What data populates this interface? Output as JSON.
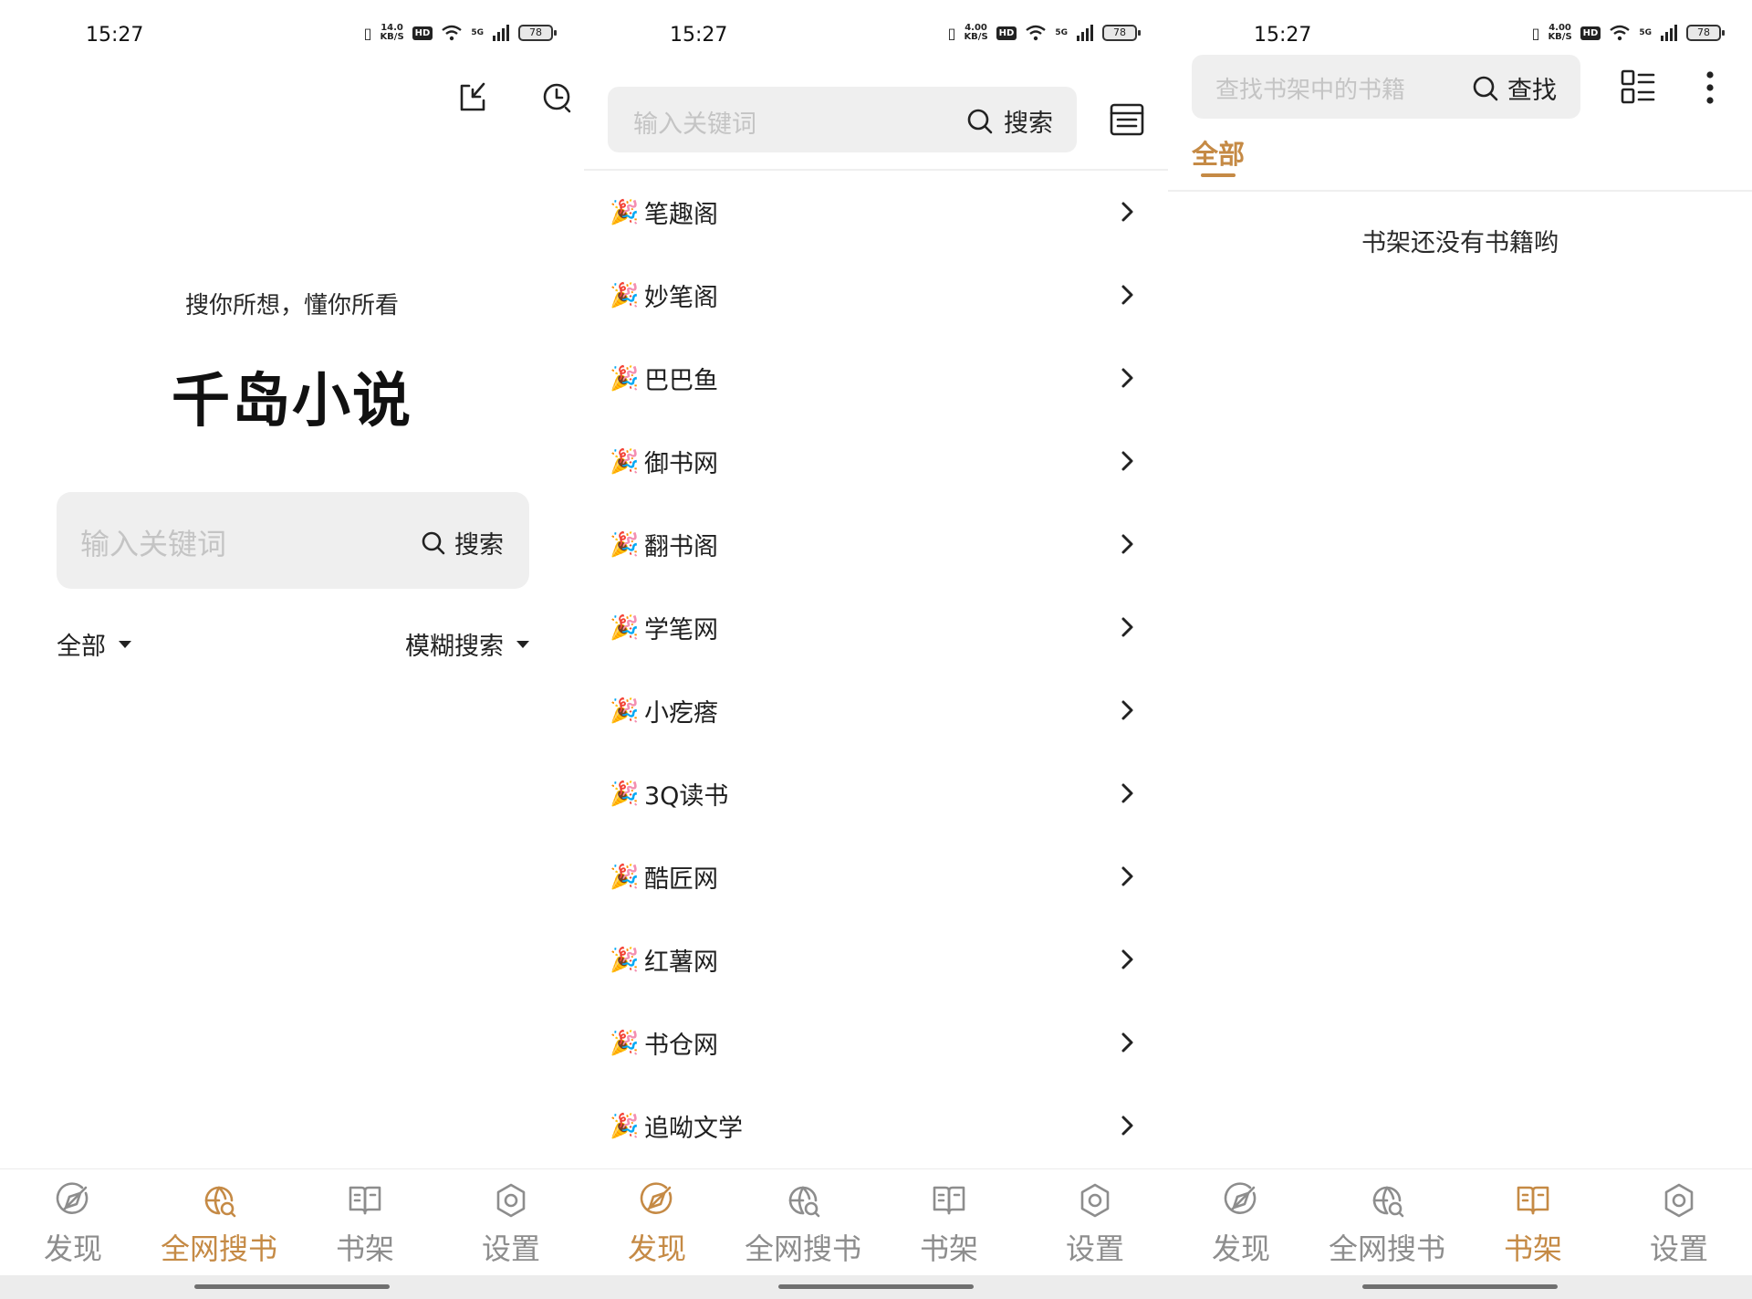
{
  "colors": {
    "accent": "#c58a45",
    "inactive": "#8d8d8d",
    "search_bg": "#efefef"
  },
  "screens": [
    {
      "status": {
        "time": "15:27",
        "speed": "14.0",
        "speed_unit": "KB/S",
        "hd": "HD",
        "network": "5G",
        "battery": "78"
      },
      "top_icons": [
        "import-icon",
        "history-icon"
      ],
      "tagline": "搜你所想，懂你所看",
      "title": "千岛小说",
      "search": {
        "placeholder": "输入关键词",
        "button": "搜索"
      },
      "filters": {
        "scope": "全部",
        "mode": "模糊搜索"
      },
      "nav": [
        {
          "label": "发现",
          "icon": "discover-icon",
          "active": false
        },
        {
          "label": "全网搜书",
          "icon": "web-search-icon",
          "active": true
        },
        {
          "label": "书架",
          "icon": "bookshelf-icon",
          "active": false
        },
        {
          "label": "设置",
          "icon": "settings-icon",
          "active": false
        }
      ]
    },
    {
      "status": {
        "time": "15:27",
        "speed": "4.00",
        "speed_unit": "KB/S",
        "hd": "HD",
        "network": "5G",
        "battery": "78"
      },
      "search": {
        "placeholder": "输入关键词",
        "button": "搜索"
      },
      "sources": [
        {
          "emoji": "🎉",
          "name": "笔趣阁"
        },
        {
          "emoji": "🎉",
          "name": "妙笔阁"
        },
        {
          "emoji": "🎉",
          "name": "巴巴鱼"
        },
        {
          "emoji": "🎉",
          "name": "御书网"
        },
        {
          "emoji": "🎉",
          "name": "翻书阁"
        },
        {
          "emoji": "🎉",
          "name": "学笔网"
        },
        {
          "emoji": "🎉",
          "name": "小疙瘩"
        },
        {
          "emoji": "🎉",
          "name": "3Q读书"
        },
        {
          "emoji": "🎉",
          "name": "酷匠网"
        },
        {
          "emoji": "🎉",
          "name": "红薯网"
        },
        {
          "emoji": "🎉",
          "name": "书仓网"
        },
        {
          "emoji": "🎉",
          "name": "追呦文学"
        }
      ],
      "nav": [
        {
          "label": "发现",
          "icon": "discover-icon",
          "active": true
        },
        {
          "label": "全网搜书",
          "icon": "web-search-icon",
          "active": false
        },
        {
          "label": "书架",
          "icon": "bookshelf-icon",
          "active": false
        },
        {
          "label": "设置",
          "icon": "settings-icon",
          "active": false
        }
      ]
    },
    {
      "status": {
        "time": "15:27",
        "speed": "4.00",
        "speed_unit": "KB/S",
        "hd": "HD",
        "network": "5G",
        "battery": "78"
      },
      "search": {
        "placeholder": "查找书架中的书籍",
        "button": "查找"
      },
      "tab": "全部",
      "empty": "书架还没有书籍哟",
      "nav": [
        {
          "label": "发现",
          "icon": "discover-icon",
          "active": false
        },
        {
          "label": "全网搜书",
          "icon": "web-search-icon",
          "active": false
        },
        {
          "label": "书架",
          "icon": "bookshelf-icon",
          "active": true
        },
        {
          "label": "设置",
          "icon": "settings-icon",
          "active": false
        }
      ]
    }
  ]
}
